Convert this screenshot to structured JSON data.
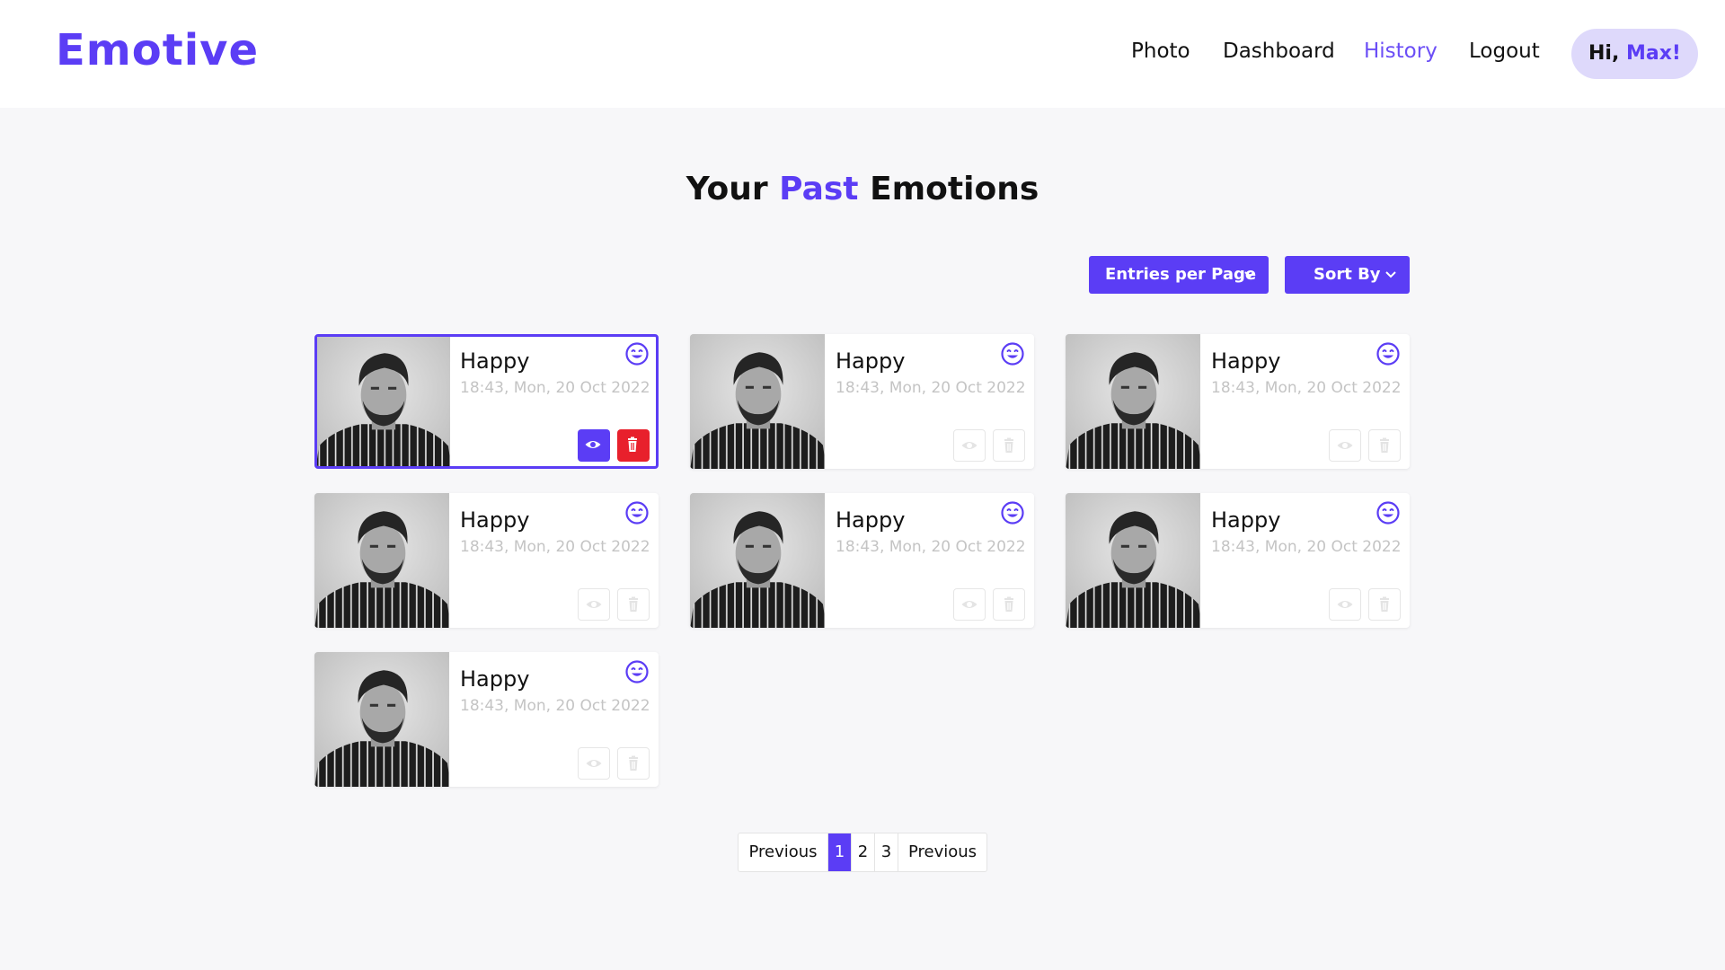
{
  "brand": {
    "name": "Emotive",
    "accent_color": "#5b3df5"
  },
  "nav": {
    "items": [
      {
        "label": "Photo",
        "active": false
      },
      {
        "label": "Dashboard",
        "active": false
      },
      {
        "label": "History",
        "active": true
      },
      {
        "label": "Logout",
        "active": false
      }
    ],
    "greeting_prefix": "Hi,",
    "greeting_name": "Max!"
  },
  "page": {
    "title_pre": "Your",
    "title_accent": "Past",
    "title_post": "Emotions"
  },
  "controls": {
    "entries_per_page_label": "Entries per Page",
    "sort_by_label": "Sort By"
  },
  "entries": [
    {
      "emotion": "Happy",
      "datetime": "18:43, Mon, 20 Oct 2022",
      "icon": "smiling-face-icon",
      "selected": true
    },
    {
      "emotion": "Happy",
      "datetime": "18:43, Mon, 20 Oct 2022",
      "icon": "smiling-face-icon",
      "selected": false
    },
    {
      "emotion": "Happy",
      "datetime": "18:43, Mon, 20 Oct 2022",
      "icon": "smiling-face-icon",
      "selected": false
    },
    {
      "emotion": "Happy",
      "datetime": "18:43, Mon, 20 Oct 2022",
      "icon": "smiling-face-icon",
      "selected": false
    },
    {
      "emotion": "Happy",
      "datetime": "18:43, Mon, 20 Oct 2022",
      "icon": "smiling-face-icon",
      "selected": false
    },
    {
      "emotion": "Happy",
      "datetime": "18:43, Mon, 20 Oct 2022",
      "icon": "smiling-face-icon",
      "selected": false
    },
    {
      "emotion": "Happy",
      "datetime": "18:43, Mon, 20 Oct 2022",
      "icon": "smiling-face-icon",
      "selected": false
    }
  ],
  "pagination": {
    "prev_label": "Previous",
    "pages": [
      "1",
      "2",
      "3"
    ],
    "current_page": "1",
    "next_label": "Previous"
  },
  "colors": {
    "delete": "#e8202c",
    "selected_border": "#5b3df5",
    "greeting_bg": "#ded9fb"
  }
}
